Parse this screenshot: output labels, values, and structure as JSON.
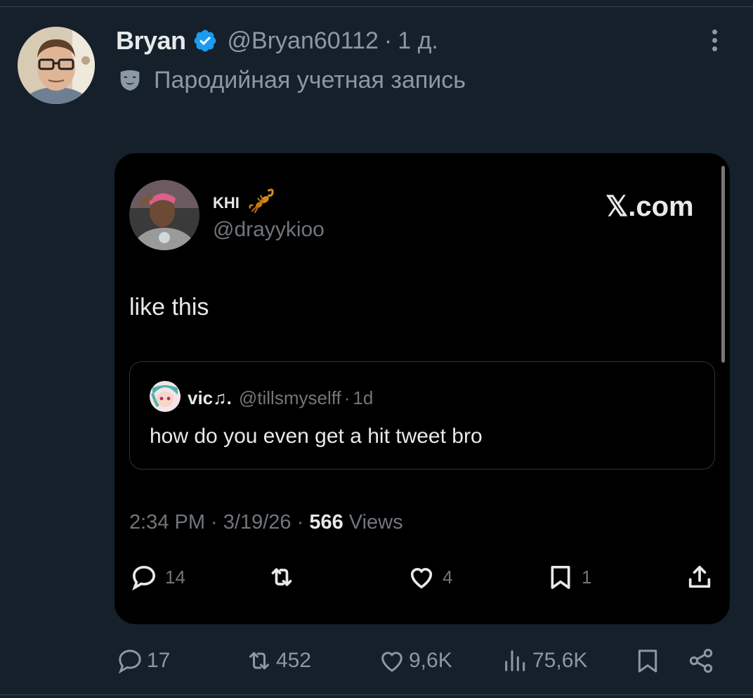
{
  "tweet": {
    "display_name": "Bryan",
    "handle": "@Bryan60112",
    "separator": "·",
    "time": "1 д.",
    "parody_label": "Пародийная учетная запись"
  },
  "media": {
    "author_name": "KHI",
    "author_handle": "@drayykioo",
    "watermark": "𝕏.com",
    "text": "like this",
    "quoted": {
      "name": "vic♫.",
      "handle": "@tillsmyselff",
      "time": "1d",
      "text": "how do you even get a hit tweet bro"
    },
    "timestamp": "2:34 PM · 3/19/26 · ",
    "views_count": "566",
    "views_label": " Views",
    "actions": {
      "replies": "14",
      "likes": "4",
      "bookmarks": "1"
    }
  },
  "actions": {
    "replies": "17",
    "reposts": "452",
    "likes": "9,6K",
    "views": "75,6K"
  },
  "colors": {
    "background": "#15202b",
    "verified": "#1d9bf0",
    "secondary_text": "#8b98a5"
  },
  "icons": [
    "verified-badge-icon",
    "more-options-icon",
    "parody-mask-icon",
    "scorpion-emoji-icon",
    "reply-icon",
    "repost-icon",
    "like-icon",
    "bookmark-icon",
    "share-icon",
    "views-icon"
  ]
}
